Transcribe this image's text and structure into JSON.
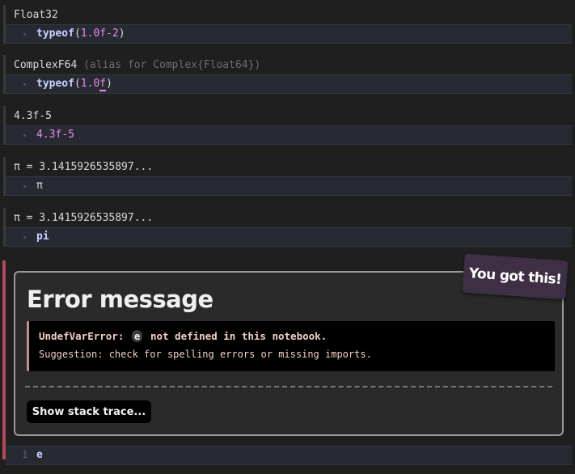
{
  "cells": [
    {
      "output": "Float32",
      "output_alias": "",
      "code": [
        {
          "t": "typeof",
          "c": "kw"
        },
        {
          "t": "(",
          "c": "plain"
        },
        {
          "t": "1.0f-2",
          "c": "num"
        },
        {
          "t": ")",
          "c": "plain"
        }
      ]
    },
    {
      "output": "ComplexF64",
      "output_alias": " (alias for Complex{Float64})",
      "code": [
        {
          "t": "typeof",
          "c": "kw"
        },
        {
          "t": "(",
          "c": "plain"
        },
        {
          "t": "1.0",
          "c": "num"
        },
        {
          "t": "f",
          "c": "num under"
        },
        {
          "t": ")",
          "c": "plain"
        }
      ]
    },
    {
      "output": "4.3f-5",
      "output_alias": "",
      "code": [
        {
          "t": "4.3f-5",
          "c": "num"
        }
      ]
    },
    {
      "output": "π = 3.1415926535897...",
      "output_alias": "",
      "code": [
        {
          "t": "π",
          "c": "plain"
        }
      ]
    },
    {
      "output": "π = 3.1415926535897...",
      "output_alias": "",
      "code": [
        {
          "t": "pi",
          "c": "kw"
        }
      ]
    }
  ],
  "error": {
    "title": "Error message",
    "error_type": "UndefVarError:",
    "variable": "e",
    "message_rest": "not defined in this notebook.",
    "suggestion": "Suggestion: check for spelling errors or missing imports.",
    "stack_button": "Show stack trace...",
    "badge": "You got this!"
  },
  "error_cell_input": {
    "line_number": "1",
    "code": "e"
  },
  "colors": {
    "background": "#1f1f1f",
    "input_bg": "#282a33",
    "keyword": "#c7d2ff",
    "number": "#e48ee6",
    "error_rail": "#b14a55",
    "badge_bg": "#3e2f45"
  }
}
